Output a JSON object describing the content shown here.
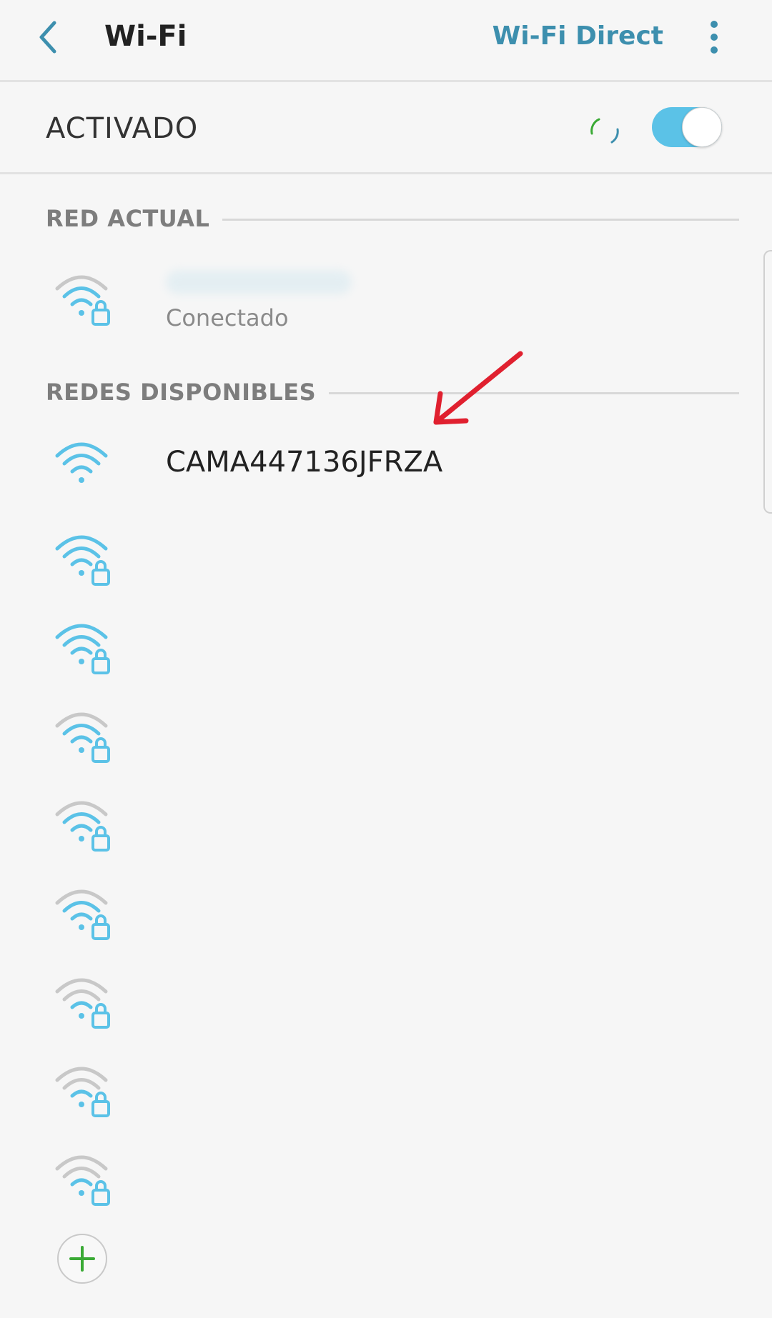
{
  "header": {
    "title": "Wi-Fi",
    "wifi_direct_label": "Wi-Fi Direct"
  },
  "master_switch": {
    "label": "ACTIVADO",
    "state": "on",
    "accent_color": "#5bc2e7"
  },
  "current_network": {
    "section_label": "RED ACTUAL",
    "status": "Conectado"
  },
  "available_networks": {
    "section_label": "REDES DISPONIBLES",
    "first_network": {
      "name": "CAMA447136JFRZA",
      "secured": false
    }
  },
  "colors": {
    "accent_text": "#3d8fae",
    "wifi_icon_strong": "#5bc2e7",
    "wifi_icon_weak": "#c8c8c8",
    "arrow_annotation": "#e0202f",
    "add_plus": "#3aaa35"
  },
  "icons": {
    "back": "back-arrow-icon",
    "more": "more-vertical-icon",
    "wifi": "wifi-signal-icon",
    "lock": "lock-icon",
    "add": "plus-icon",
    "spinner": "loading-spinner-icon"
  }
}
